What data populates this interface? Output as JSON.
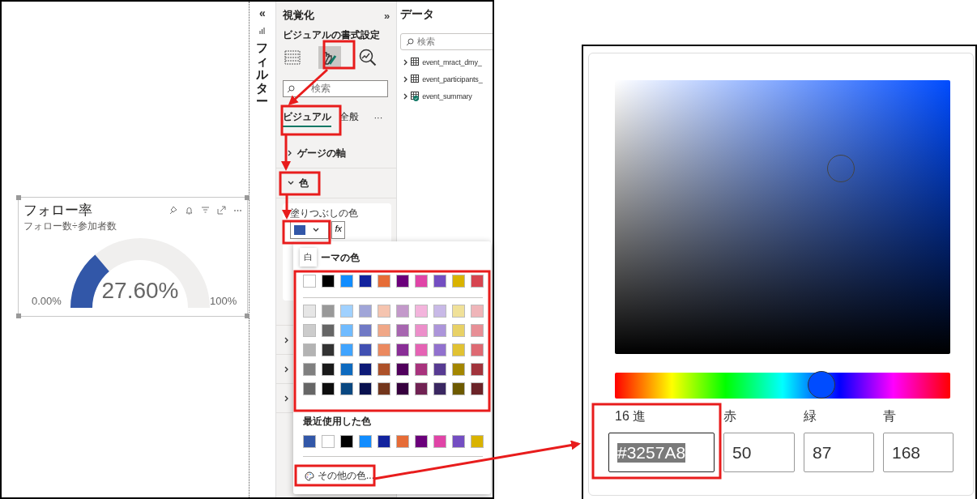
{
  "canvas": {
    "gauge_card": {
      "title": "フォロー率",
      "subtitle": "フォロー数÷参加者数",
      "value": "27.60%",
      "min": "0.00%",
      "max": "100%",
      "level": 0.276
    }
  },
  "filter_pane": {
    "collapse": "«",
    "title": "フィルター"
  },
  "visualizations_pane": {
    "title": "視覚化",
    "expand": "»",
    "subtitle": "ビジュアルの書式設定",
    "search": {
      "placeholder": "検索"
    },
    "tabs": [
      {
        "label": "ビジュアル",
        "selected": true
      },
      {
        "label": "全般",
        "selected": false
      }
    ],
    "more": "···",
    "sections": [
      {
        "label": "ゲージの軸",
        "expanded": false
      },
      {
        "label": "色",
        "expanded": true
      }
    ],
    "fill_label": "塗りつぶしの色",
    "fill_color": {
      "color": "#3257a8"
    },
    "fx": "fx"
  },
  "data_pane": {
    "title": "データ",
    "search": {
      "placeholder": "検索"
    },
    "tables": [
      {
        "name": "event_mract_dmy_",
        "badge": false
      },
      {
        "name": "event_participants_",
        "badge": false
      },
      {
        "name": "event_summary",
        "badge": true
      }
    ]
  },
  "color_popup": {
    "tooltip": "白",
    "theme_heading": "ーマの色",
    "theme_colors": [
      {
        "color": "#ffffff"
      },
      {
        "color": "#000000"
      },
      {
        "color": "#118dff"
      },
      {
        "color": "#12239e"
      },
      {
        "color": "#e66c37"
      },
      {
        "color": "#6b007b"
      },
      {
        "color": "#e044a7"
      },
      {
        "color": "#744ec2"
      },
      {
        "color": "#d9b300"
      },
      {
        "color": "#d64550"
      }
    ],
    "shade_rows": [
      [
        {
          "color": "#e6e6e6"
        },
        {
          "color": "#999999"
        },
        {
          "color": "#a0d1ff"
        },
        {
          "color": "#a0a5d8"
        },
        {
          "color": "#f5c4af"
        },
        {
          "color": "#c399ca"
        },
        {
          "color": "#f3b4dc"
        },
        {
          "color": "#c8b9e7"
        },
        {
          "color": "#f0e199"
        },
        {
          "color": "#efb5b9"
        }
      ],
      [
        {
          "color": "#cccccc"
        },
        {
          "color": "#666666"
        },
        {
          "color": "#70bbff"
        },
        {
          "color": "#7079c5"
        },
        {
          "color": "#f0a787"
        },
        {
          "color": "#a766b0"
        },
        {
          "color": "#ec8fca"
        },
        {
          "color": "#ac95da"
        },
        {
          "color": "#e8d166"
        },
        {
          "color": "#e78f96"
        }
      ],
      [
        {
          "color": "#b3b3b3"
        },
        {
          "color": "#333333"
        },
        {
          "color": "#40a4ff"
        },
        {
          "color": "#4150b2"
        },
        {
          "color": "#eb895f"
        },
        {
          "color": "#892e96"
        },
        {
          "color": "#e563b4"
        },
        {
          "color": "#9171ce"
        },
        {
          "color": "#e1c233"
        },
        {
          "color": "#de6a73"
        }
      ],
      [
        {
          "color": "#808080"
        },
        {
          "color": "#1a1a1a"
        },
        {
          "color": "#0d6abf"
        },
        {
          "color": "#0d1a77"
        },
        {
          "color": "#ad5129"
        },
        {
          "color": "#50005c"
        },
        {
          "color": "#a8337d"
        },
        {
          "color": "#573b92"
        },
        {
          "color": "#a38600"
        },
        {
          "color": "#a1343c"
        }
      ],
      [
        {
          "color": "#666666"
        },
        {
          "color": "#0d0d0d"
        },
        {
          "color": "#094780"
        },
        {
          "color": "#09114f"
        },
        {
          "color": "#73361c"
        },
        {
          "color": "#36003e"
        },
        {
          "color": "#702253"
        },
        {
          "color": "#3a2761"
        },
        {
          "color": "#6d5a00"
        },
        {
          "color": "#6b2328"
        }
      ]
    ],
    "recent_heading": "最近使用した色",
    "recent_colors": [
      {
        "color": "#3257a8"
      },
      {
        "color": "#ffffff"
      },
      {
        "color": "#000000"
      },
      {
        "color": "#118dff"
      },
      {
        "color": "#12239e"
      },
      {
        "color": "#e66c37"
      },
      {
        "color": "#6b007b"
      },
      {
        "color": "#e044a7"
      },
      {
        "color": "#744ec2"
      },
      {
        "color": "#d9b300"
      }
    ],
    "more_colors": "その他の色..."
  },
  "color_picker": {
    "hue": {
      "level": 0.617
    },
    "fields": [
      {
        "label": "16 進",
        "value": "#3257A8",
        "text_selected": true
      },
      {
        "label": "赤",
        "value": "50",
        "text_selected": false
      },
      {
        "label": "緑",
        "value": "87",
        "text_selected": false
      },
      {
        "label": "青",
        "value": "168",
        "text_selected": false
      }
    ]
  }
}
